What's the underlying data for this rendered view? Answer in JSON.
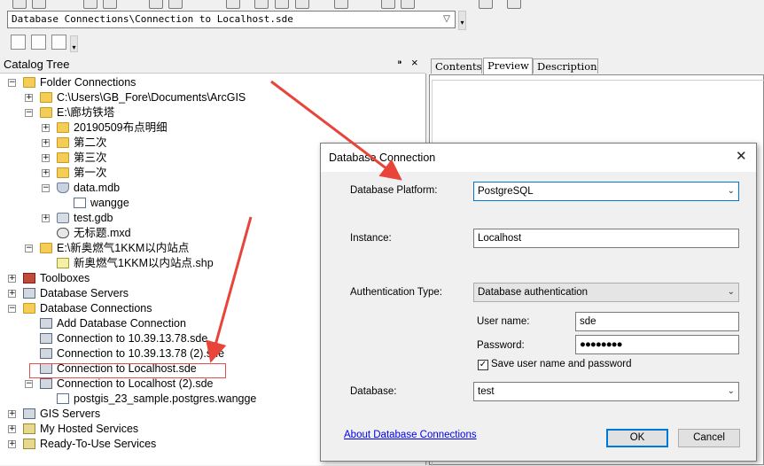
{
  "location": {
    "path": "Database Connections\\Connection to Localhost.sde"
  },
  "catalog": {
    "title": "Catalog Tree",
    "pin_glyph": "⁍",
    "close_glyph": "×",
    "items": [
      {
        "label": "Folder Connections",
        "icon": "folder-icon",
        "expander": "−"
      },
      {
        "label": "C:\\Users\\GB_Fore\\Documents\\ArcGIS",
        "icon": "folder-icon",
        "expander": "+"
      },
      {
        "label": "E:\\廊坊铁塔",
        "icon": "folder-icon",
        "expander": "−"
      },
      {
        "label": "20190509布点明细",
        "icon": "folder-icon",
        "expander": "+"
      },
      {
        "label": "第二次",
        "icon": "folder-icon",
        "expander": "+"
      },
      {
        "label": "第三次",
        "icon": "folder-icon",
        "expander": "+"
      },
      {
        "label": "第一次",
        "icon": "folder-icon",
        "expander": "+"
      },
      {
        "label": "data.mdb",
        "icon": "database-icon",
        "expander": "−"
      },
      {
        "label": "wangge",
        "icon": "feature-class-icon",
        "expander": ""
      },
      {
        "label": "test.gdb",
        "icon": "geodatabase-icon",
        "expander": "+"
      },
      {
        "label": "无标题.mxd",
        "icon": "map-document-icon",
        "expander": ""
      },
      {
        "label": "E:\\新奥燃气1KKM以内站点",
        "icon": "folder-icon",
        "expander": "−"
      },
      {
        "label": "新奥燃气1KKM以内站点.shp",
        "icon": "shapefile-icon",
        "expander": ""
      },
      {
        "label": "Toolboxes",
        "icon": "toolbox-icon",
        "expander": "+"
      },
      {
        "label": "Database Servers",
        "icon": "server-icon",
        "expander": "+"
      },
      {
        "label": "Database Connections",
        "icon": "folder-icon",
        "expander": "−"
      },
      {
        "label": "Add Database Connection",
        "icon": "add-connection-icon",
        "expander": ""
      },
      {
        "label": "Connection to 10.39.13.78.sde",
        "icon": "broken-connection-icon",
        "expander": ""
      },
      {
        "label": "Connection to 10.39.13.78 (2).sde",
        "icon": "broken-connection-icon",
        "expander": ""
      },
      {
        "label": "Connection to Localhost.sde",
        "icon": "connection-icon",
        "expander": ""
      },
      {
        "label": "Connection to Localhost (2).sde",
        "icon": "connection-icon",
        "expander": "−"
      },
      {
        "label": "postgis_23_sample.postgres.wangge",
        "icon": "feature-class-icon",
        "expander": ""
      },
      {
        "label": "GIS Servers",
        "icon": "gis-server-icon",
        "expander": "+"
      },
      {
        "label": "My Hosted Services",
        "icon": "hosted-services-icon",
        "expander": "+"
      },
      {
        "label": "Ready-To-Use Services",
        "icon": "ready-services-icon",
        "expander": "+"
      }
    ]
  },
  "tabs": [
    {
      "label": "Contents"
    },
    {
      "label": "Preview"
    },
    {
      "label": "Description"
    }
  ],
  "dialog": {
    "title": "Database Connection",
    "close_glyph": "✕",
    "platform_label": "Database Platform:",
    "platform_value": "PostgreSQL",
    "instance_label": "Instance:",
    "instance_value": "Localhost",
    "auth_label": "Authentication Type:",
    "auth_value": "Database authentication",
    "username_label": "User name:",
    "username_value": "sde",
    "password_label": "Password:",
    "password_value": "●●●●●●●●",
    "save_label": "Save user name and password",
    "save_checked": "✓",
    "database_label": "Database:",
    "database_value": "test",
    "about_link": "About Database Connections",
    "ok_label": "OK",
    "cancel_label": "Cancel"
  },
  "colors": {
    "arrow": "#e8443a",
    "accent": "#0078d7"
  }
}
